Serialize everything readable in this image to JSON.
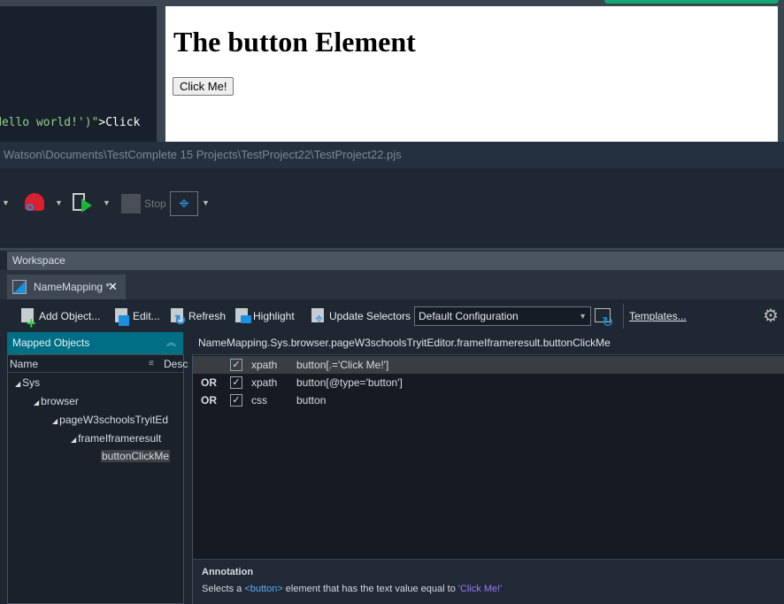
{
  "code_editor": {
    "line_green": "Hello world!')\"",
    "line_white": ">Click"
  },
  "browser": {
    "heading": "The button Element",
    "button_label": "Click Me!"
  },
  "title_bar": {
    "path": "Watson\\Documents\\TestComplete 15 Projects\\TestProject22\\TestProject22.pjs"
  },
  "toolbar": {
    "stop_label": "Stop"
  },
  "workspace": {
    "label": "Workspace",
    "tab_label": "NameMapping *"
  },
  "name_mapping_toolbar": {
    "add_object": "Add Object...",
    "edit": "Edit...",
    "refresh": "Refresh",
    "highlight": "Highlight",
    "update_selectors": "Update Selectors",
    "configuration": "Default Configuration",
    "templates": "Templates..."
  },
  "mapped_objects": {
    "title": "Mapped Objects",
    "col_name": "Name",
    "col_desc": "Desc",
    "tree": [
      "Sys",
      "browser",
      "pageW3schoolsTryitEd",
      "frameIframeresult",
      "buttonClickMe"
    ]
  },
  "selected_path": "NameMapping.Sys.browser.pageW3schoolsTryitEditor.frameIframeresult.buttonClickMe",
  "selectors": [
    {
      "op": "",
      "checked": true,
      "type": "xpath",
      "value": "button[.='Click Me!']"
    },
    {
      "op": "OR",
      "checked": true,
      "type": "xpath",
      "value": "button[@type='button']"
    },
    {
      "op": "OR",
      "checked": true,
      "type": "css",
      "value": "button"
    }
  ],
  "annotation": {
    "title": "Annotation",
    "pre": "Selects a ",
    "tag": "<button>",
    "mid": " element that has the text value equal to ",
    "str": "'Click Me!'"
  },
  "colors": {
    "accent": "#006f86",
    "background": "#1f2733",
    "selection": "#3a3d42"
  }
}
